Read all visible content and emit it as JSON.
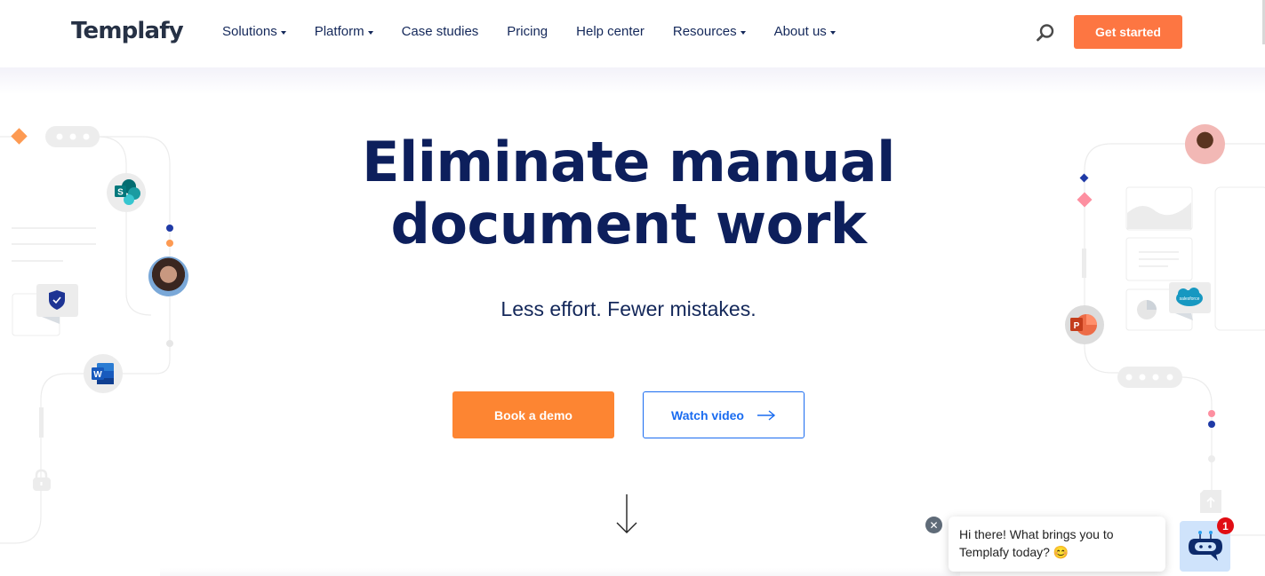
{
  "header": {
    "logo": "Templafy",
    "nav": [
      {
        "label": "Solutions",
        "dropdown": true
      },
      {
        "label": "Platform",
        "dropdown": true
      },
      {
        "label": "Case studies",
        "dropdown": false
      },
      {
        "label": "Pricing",
        "dropdown": false
      },
      {
        "label": "Help center",
        "dropdown": false
      },
      {
        "label": "Resources",
        "dropdown": true
      },
      {
        "label": "About us",
        "dropdown": true
      }
    ],
    "search_icon": "search-icon",
    "cta_label": "Get started"
  },
  "hero": {
    "title_line1": "Eliminate manual",
    "title_line2": "document work",
    "subtitle": "Less effort. Fewer mistakes.",
    "primary_button": "Book a demo",
    "secondary_button": "Watch video",
    "secondary_icon": "arrow-right-icon",
    "scroll_icon": "arrow-down-icon"
  },
  "decorations": {
    "left_icons": [
      "sharepoint-icon",
      "shield-check-icon",
      "word-icon",
      "lock-icon",
      "avatar-woman"
    ],
    "right_icons": [
      "avatar-man",
      "powerpoint-icon",
      "salesforce-icon",
      "upload-icon"
    ],
    "salesforce_text": "salesforce"
  },
  "chat": {
    "message": "Hi there! What brings you to Templafy today? 😊",
    "badge_count": "1",
    "close_icon": "close-icon",
    "bot_icon": "chatbot-icon"
  },
  "colors": {
    "brand_navy": "#0d1f5c",
    "accent_orange": "#fd7642",
    "demo_orange": "#fd8532",
    "link_blue": "#1a6cf0",
    "badge_red": "#e10d14"
  }
}
